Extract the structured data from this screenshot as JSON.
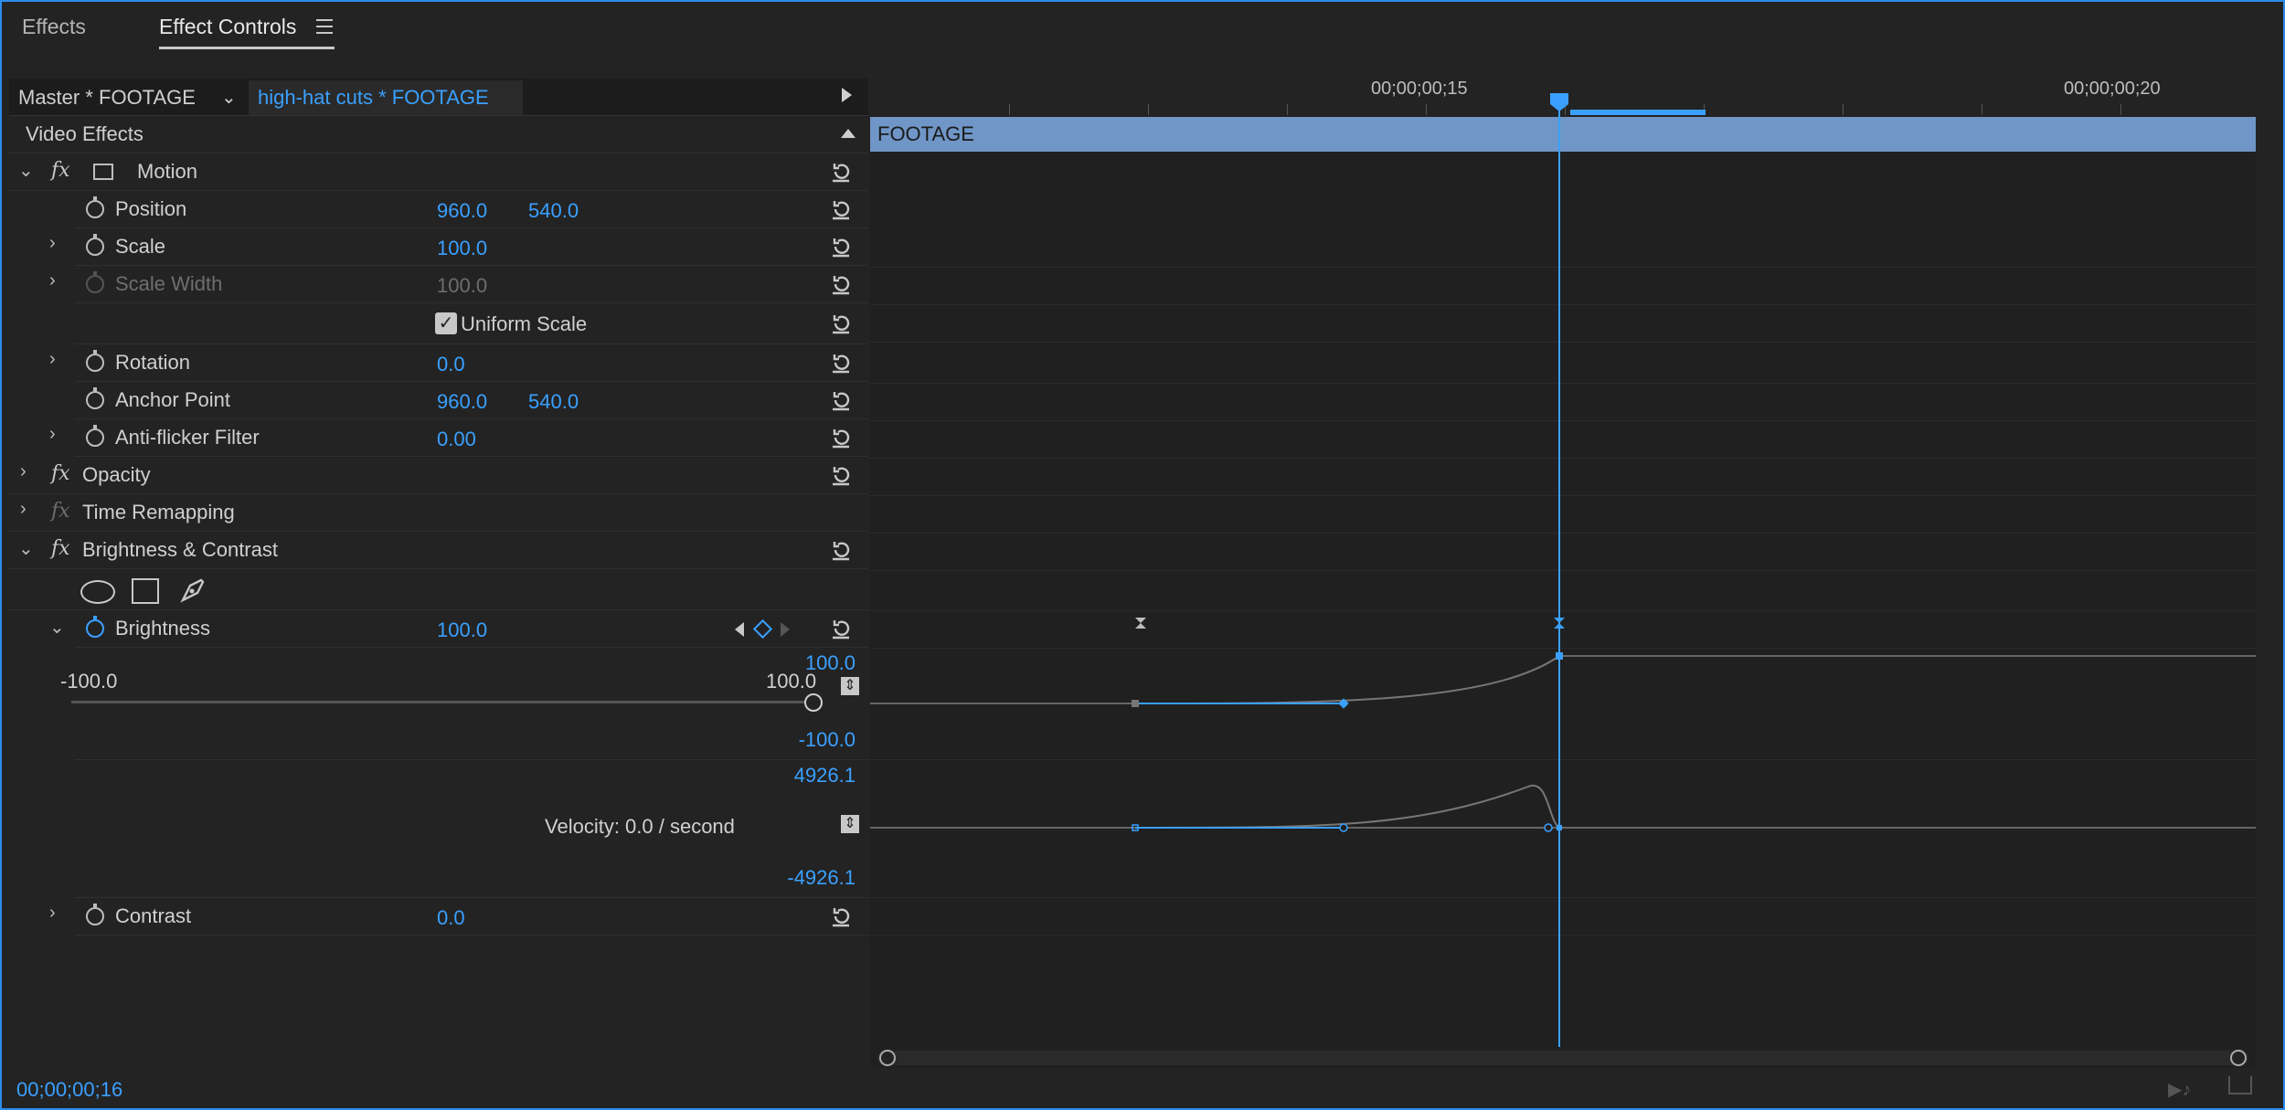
{
  "tabs": {
    "effects": "Effects",
    "effect_controls": "Effect Controls"
  },
  "header": {
    "master": "Master * FOOTAGE",
    "clip": "high-hat cuts * FOOTAGE"
  },
  "section": "Video Effects",
  "motion": {
    "name": "Motion",
    "position": {
      "label": "Position",
      "x": "960.0",
      "y": "540.0"
    },
    "scale": {
      "label": "Scale",
      "value": "100.0"
    },
    "scale_width": {
      "label": "Scale Width",
      "value": "100.0"
    },
    "uniform_scale": {
      "label": "Uniform Scale",
      "checked": true
    },
    "rotation": {
      "label": "Rotation",
      "value": "0.0"
    },
    "anchor": {
      "label": "Anchor Point",
      "x": "960.0",
      "y": "540.0"
    },
    "antiflicker": {
      "label": "Anti-flicker Filter",
      "value": "0.00"
    }
  },
  "opacity": {
    "name": "Opacity"
  },
  "time_remap": {
    "name": "Time Remapping"
  },
  "bc": {
    "name": "Brightness & Contrast",
    "brightness": {
      "label": "Brightness",
      "value": "100.0",
      "graph_max": "100.0",
      "graph_min": "-100.0",
      "slider_min": "-100.0",
      "slider_max": "100.0",
      "vel_max": "4926.1",
      "vel_min": "-4926.1",
      "velocity": "Velocity: 0.0 / second"
    },
    "contrast": {
      "label": "Contrast",
      "value": "0.0"
    }
  },
  "timeline": {
    "tc1": "00;00;00;15",
    "tc2": "00;00;00;20",
    "clip": "FOOTAGE"
  },
  "current_time": "00;00;00;16",
  "colors": {
    "accent": "#3aa0ff",
    "clip": "#6f96c6",
    "border": "#2d8ceb"
  }
}
